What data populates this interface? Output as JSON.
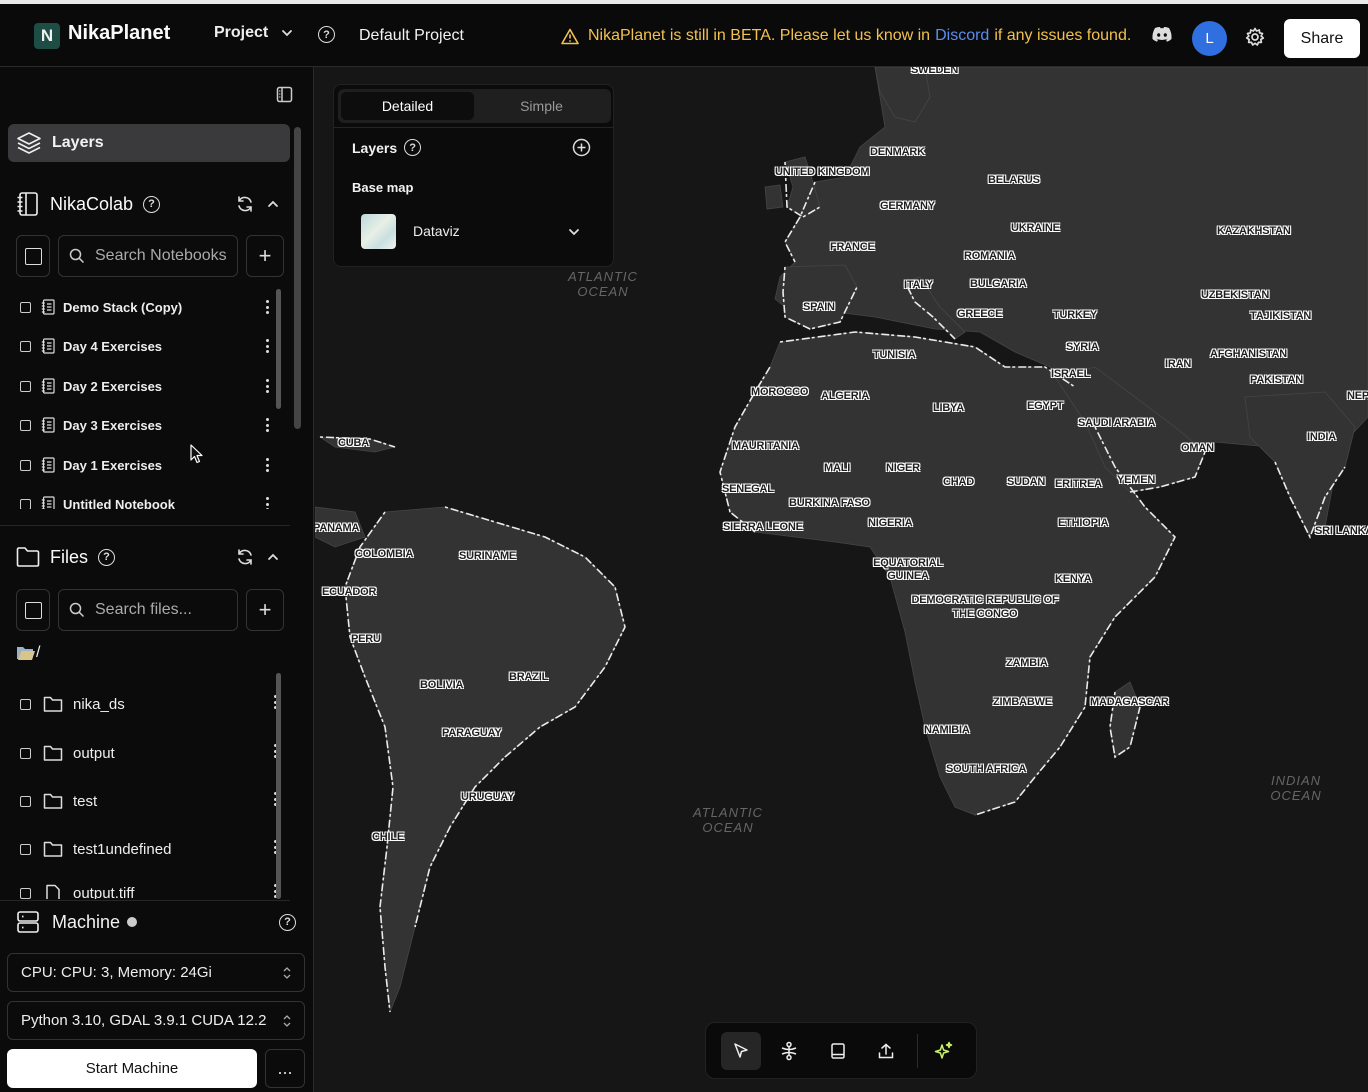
{
  "app": {
    "logo_letter": "N",
    "name": "NikaPlanet"
  },
  "topbar": {
    "project_menu_label": "Project",
    "project_name": "Default Project",
    "beta_before": "NikaPlanet is still in BETA. Please let us know in",
    "beta_link": "Discord",
    "beta_after": "if any issues found.",
    "avatar_letter": "L",
    "share_label": "Share"
  },
  "sidebar": {
    "layers_tab": "Layers",
    "nikacolab": {
      "title": "NikaColab",
      "search_placeholder": "Search Notebooks...",
      "notebooks": [
        "Demo Stack (Copy)",
        "Day 4 Exercises",
        "Day 2 Exercises",
        "Day 3 Exercises",
        "Day 1 Exercises",
        "Untitled Notebook"
      ]
    },
    "files": {
      "title": "Files",
      "search_placeholder": "Search files...",
      "path": "/",
      "items": [
        {
          "name": "nika_ds",
          "type": "folder"
        },
        {
          "name": "output",
          "type": "folder"
        },
        {
          "name": "test",
          "type": "folder"
        },
        {
          "name": "test1undefined",
          "type": "folder"
        },
        {
          "name": "output.tiff",
          "type": "file"
        }
      ]
    },
    "machine": {
      "title": "Machine",
      "cpu_option": "CPU: CPU: 3, Memory: 24Gi",
      "env_option": "Python 3.10, GDAL 3.9.1 CUDA 12.2",
      "start_label": "Start Machine",
      "more_label": "..."
    }
  },
  "layers_panel": {
    "tab_detailed": "Detailed",
    "tab_simple": "Simple",
    "layers_label": "Layers",
    "basemap_label": "Base map",
    "basemap_value": "Dataviz"
  },
  "map": {
    "oceans": [
      "ATLANTIC OCEAN",
      "ATLANTIC OCEAN",
      "INDIAN OCEAN"
    ],
    "countries": [
      "SWEDEN",
      "DENMARK",
      "UNITED KINGDOM",
      "BELARUS",
      "GERMANY",
      "UKRAINE",
      "FRANCE",
      "ROMANIA",
      "KAZAKHSTAN",
      "ITALY",
      "BULGARIA",
      "SPAIN",
      "GREECE",
      "TURKEY",
      "UZBEKISTAN",
      "TAJIKISTAN",
      "TUNISIA",
      "SYRIA",
      "AFGHANISTAN",
      "IRAN",
      "PAKISTAN",
      "MOROCCO",
      "ALGERIA",
      "LIBYA",
      "EGYPT",
      "ISRAEL",
      "SAUDI ARABIA",
      "NEPAL",
      "INDIA",
      "OMAN",
      "CUBA",
      "MAURITANIA",
      "MALI",
      "NIGER",
      "CHAD",
      "SUDAN",
      "ERITREA",
      "YEMEN",
      "SENEGAL",
      "BURKINA FASO",
      "SIERRA LEONE",
      "NIGERIA",
      "ETHIOPIA",
      "SRI LANKA",
      "PANAMA",
      "COLOMBIA",
      "SURINAME",
      "EQUATORIAL GUINEA",
      "KENYA",
      "ECUADOR",
      "DEMOCRATIC REPUBLIC OF THE CONGO",
      "PERU",
      "BRAZIL",
      "BOLIVIA",
      "ZAMBIA",
      "MADAGASCAR",
      "ZIMBABWE",
      "PARAGUAY",
      "NAMIBIA",
      "SOUTH AFRICA",
      "URUGUAY",
      "CHILE"
    ]
  },
  "colors": {
    "accent_beta": "#f2c14e",
    "link": "#5b8cf0",
    "avatar": "#2f6fe0",
    "sparkle": "#c8f26a"
  }
}
